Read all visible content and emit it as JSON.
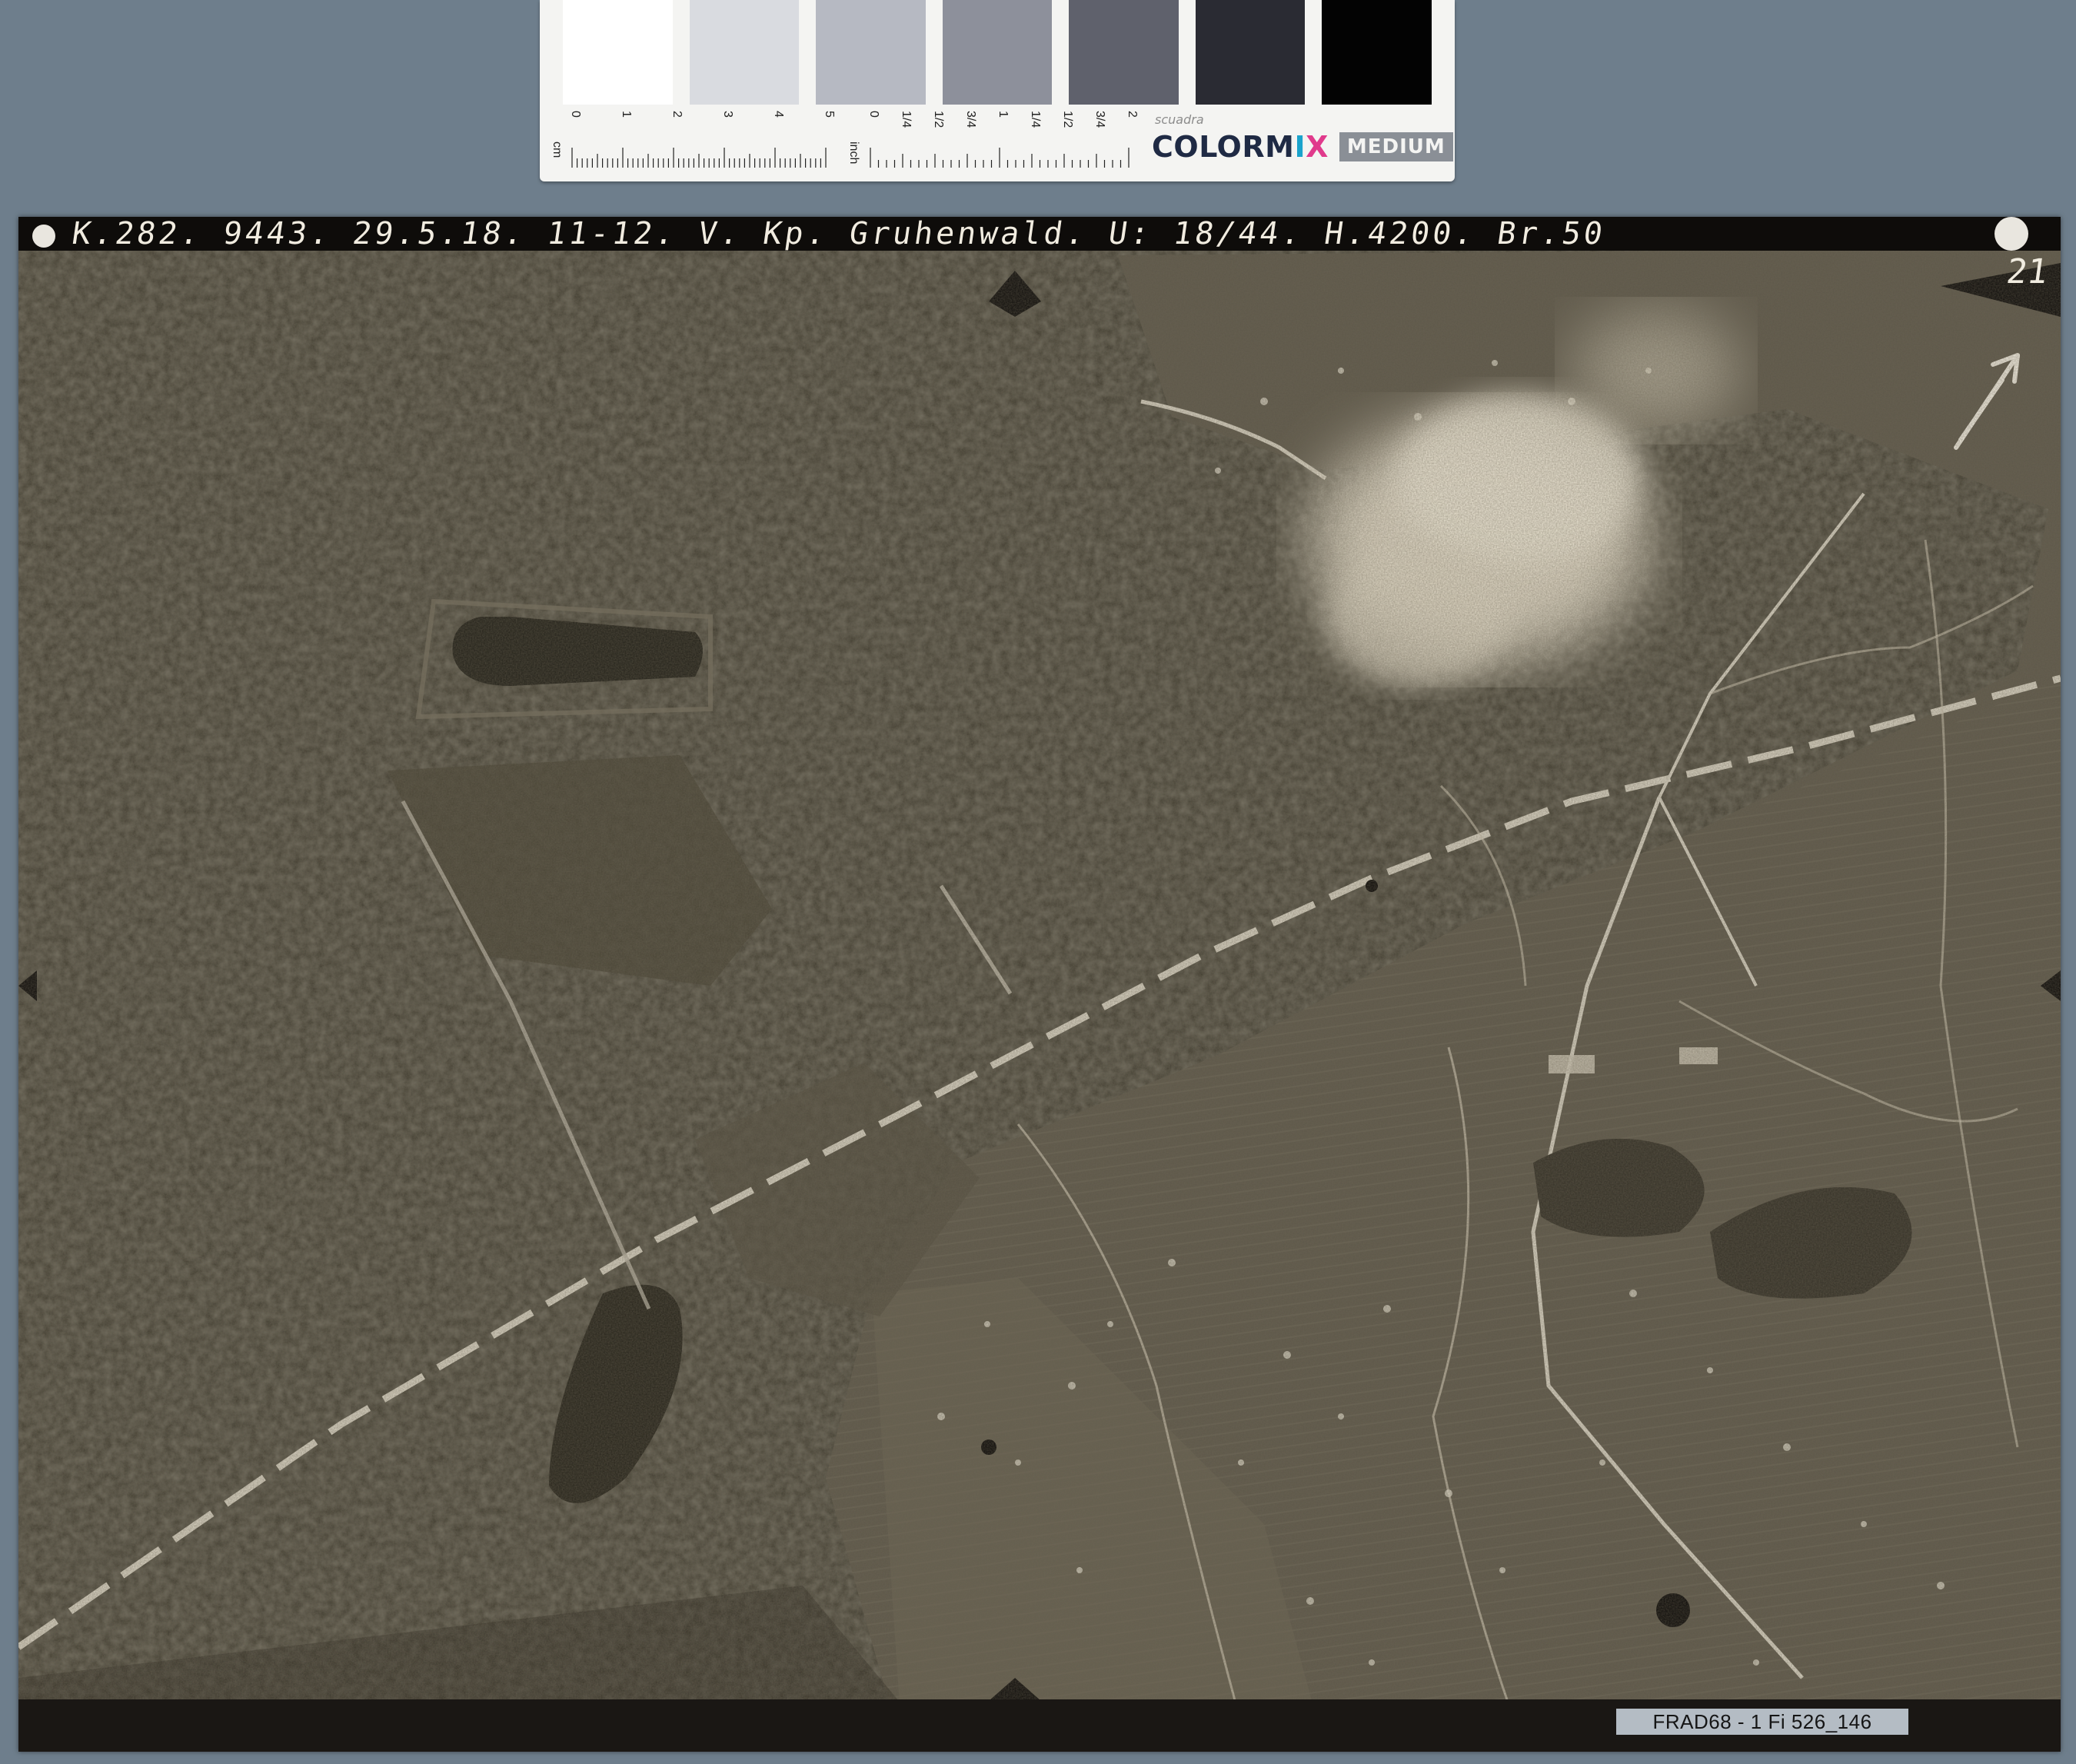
{
  "color_target": {
    "swatches": [
      "#ffffff",
      "#d9dbe0",
      "#b6b9c2",
      "#8d909b",
      "#5f616c",
      "#2a2b33",
      "#030303"
    ],
    "cm_label": "cm",
    "cm_ticks": [
      "0",
      "1",
      "2",
      "3",
      "4",
      "5"
    ],
    "inch_label": "inch",
    "inch_ticks": [
      "0",
      "1/4",
      "1/2",
      "3/4",
      "1",
      "1/4",
      "1/2",
      "3/4",
      "2"
    ],
    "brand_maker": "scuadra",
    "brand_color": "COLOR",
    "brand_m": "M",
    "brand_i": "I",
    "brand_x": "X",
    "brand_tag": "MEDIUM"
  },
  "photo": {
    "caption": "K.282. 9443. 29.5.18. 11-12. V. Kp. Gruhenwald. U: 18/44. H.4200. Br.50",
    "caption_corner": "21",
    "colors": {
      "forest": "#3b372b",
      "field": "#5e584a",
      "road": "#d8d2c2",
      "cloud": "#e7dfcc"
    }
  },
  "archive_ref": "FRAD68 - 1 Fi 526_146"
}
